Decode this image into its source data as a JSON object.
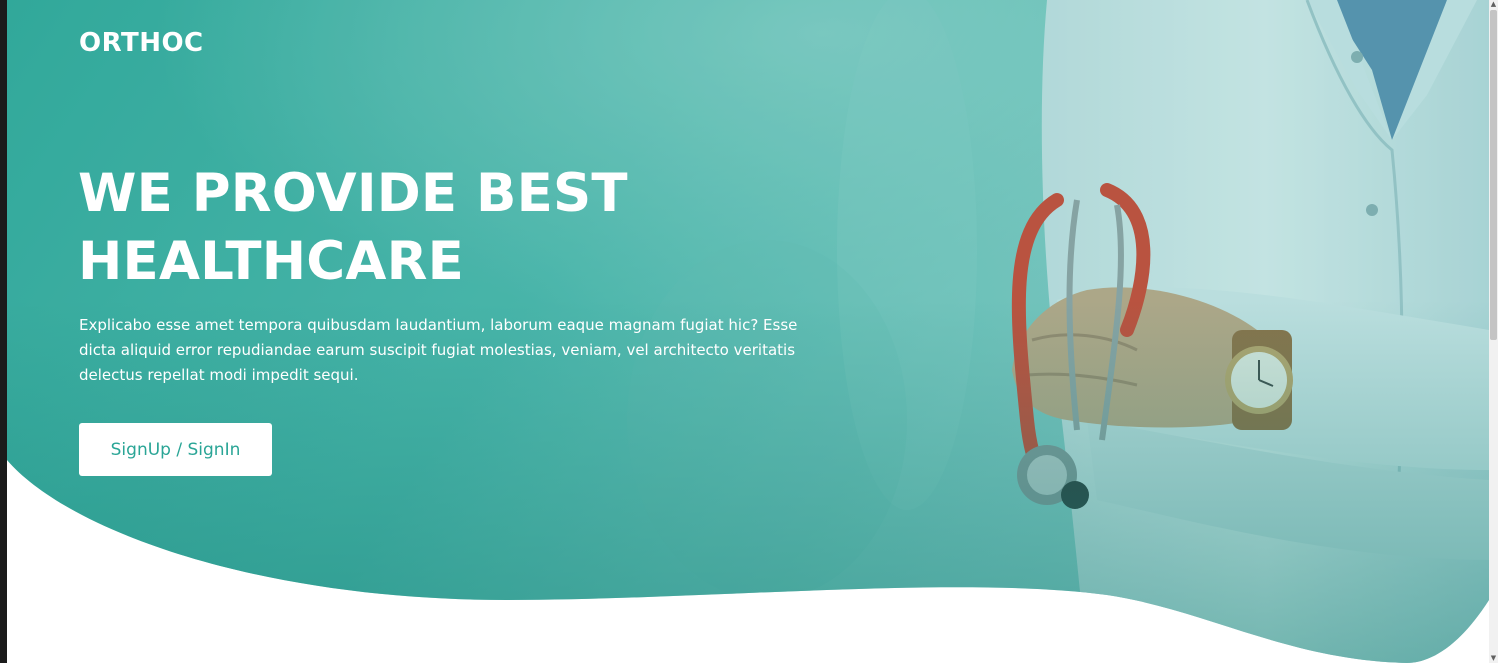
{
  "brand": {
    "name": "ORTHOC"
  },
  "hero": {
    "title_line1": "WE PROVIDE BEST",
    "title_line2": "HEALTHCARE",
    "description": "Explicabo esse amet tempora quibusdam laudantium, laborum eaque magnam fugiat hic? Esse dicta aliquid error repudiandae earum suscipit fugiat molestias, veniam, vel architecto veritatis delectus repellat modi impedit sequi.",
    "cta_label": "SignUp / SignIn"
  },
  "hero_image": {
    "subject": "doctor-with-stethoscope"
  },
  "colors": {
    "overlay": "#2aa596",
    "accent_dark": "#14857a",
    "button_text": "#2aa596",
    "text": "#ffffff",
    "page_bg": "#ffffff"
  },
  "icons": {
    "scroll_up": "▲",
    "scroll_down": "▼"
  }
}
